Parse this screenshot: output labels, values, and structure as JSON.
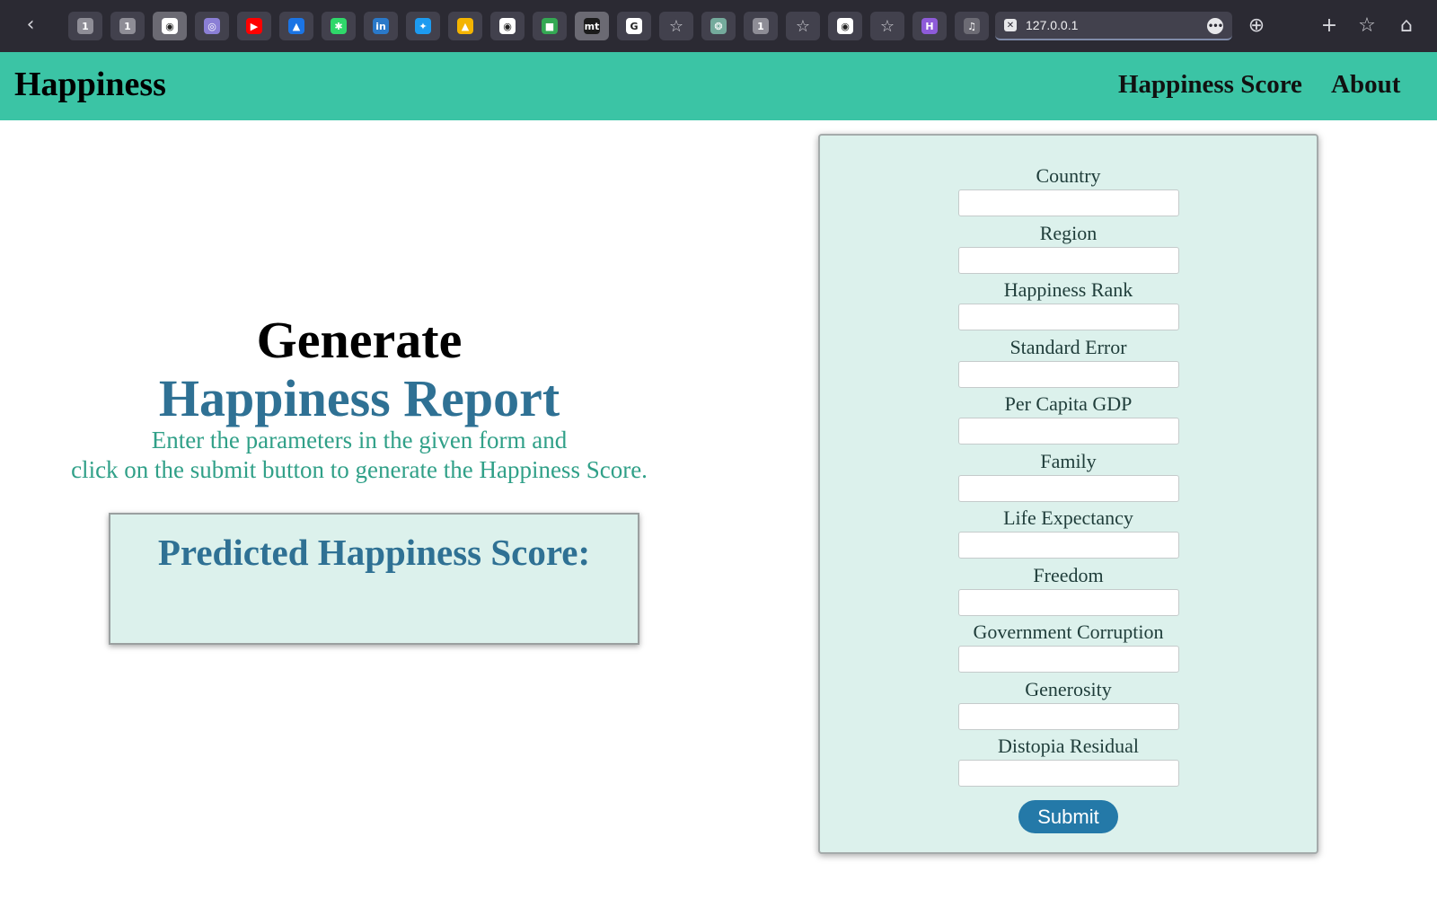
{
  "browser": {
    "tabs": [
      {
        "icon": "tab-1-icon",
        "glyph": "1",
        "color": "#8e8d96"
      },
      {
        "icon": "tab-1-icon",
        "glyph": "1",
        "color": "#8e8d96"
      },
      {
        "icon": "github-icon",
        "glyph": "◉",
        "color": "#ffffff",
        "active": true
      },
      {
        "icon": "tab-site-icon",
        "glyph": "◎",
        "color": "#8b7fd6"
      },
      {
        "icon": "youtube-icon",
        "glyph": "▶",
        "color": "#ff0000"
      },
      {
        "icon": "bluesky-icon",
        "glyph": "▲",
        "color": "#1b74e4"
      },
      {
        "icon": "green-app-icon",
        "glyph": "✱",
        "color": "#2fd86a"
      },
      {
        "icon": "linkedin-icon",
        "glyph": "in",
        "color": "#2a79c9"
      },
      {
        "icon": "twitter-icon",
        "glyph": "✦",
        "color": "#1d9bf0"
      },
      {
        "icon": "google-drive-icon",
        "glyph": "▲",
        "color": "#f4b400"
      },
      {
        "icon": "github-icon",
        "glyph": "◉",
        "color": "#ffffff"
      },
      {
        "icon": "google-workspace-icon",
        "glyph": "■",
        "color": "#34a853"
      },
      {
        "icon": "mt-icon",
        "glyph": "mt",
        "color": "#1b1b1b",
        "active": true
      },
      {
        "icon": "google-icon",
        "glyph": "G",
        "color": "#ffffff"
      },
      {
        "icon": "star-icon",
        "glyph": "☆",
        "color": "transparent"
      },
      {
        "icon": "chatgpt-icon",
        "glyph": "❂",
        "color": "#74aa9c"
      },
      {
        "icon": "tab-1-icon",
        "glyph": "1",
        "color": "#8e8d96"
      },
      {
        "icon": "star-icon",
        "glyph": "☆",
        "color": "transparent"
      },
      {
        "icon": "github-icon",
        "glyph": "◉",
        "color": "#ffffff"
      },
      {
        "icon": "star-icon",
        "glyph": "☆",
        "color": "transparent"
      },
      {
        "icon": "h-app-icon",
        "glyph": "H",
        "color": "#8e5bd9"
      },
      {
        "icon": "music-icon",
        "glyph": "♫",
        "color": "#6c6b74"
      }
    ],
    "url": "127.0.0.1"
  },
  "navbar": {
    "brand": "Happiness",
    "links": [
      "Happiness Score",
      "About"
    ],
    "color": "#3bc4a5"
  },
  "hero": {
    "title_line1": "Generate",
    "title_line2": "Happiness Report",
    "desc_line1": "Enter the parameters in the given form and",
    "desc_line2": "click on the submit button to generate the Happiness Score.",
    "result_label": "Predicted Happiness Score:"
  },
  "form": {
    "fields": [
      {
        "label": "Country",
        "value": ""
      },
      {
        "label": "Region",
        "value": ""
      },
      {
        "label": "Happiness Rank",
        "value": ""
      },
      {
        "label": "Standard Error",
        "value": ""
      },
      {
        "label": "Per Capita GDP",
        "value": ""
      },
      {
        "label": "Family",
        "value": ""
      },
      {
        "label": "Life Expectancy",
        "value": ""
      },
      {
        "label": "Freedom",
        "value": ""
      },
      {
        "label": "Government Corruption",
        "value": ""
      },
      {
        "label": "Generosity",
        "value": ""
      },
      {
        "label": "Distopia Residual",
        "value": ""
      }
    ],
    "submit_label": "Submit"
  }
}
